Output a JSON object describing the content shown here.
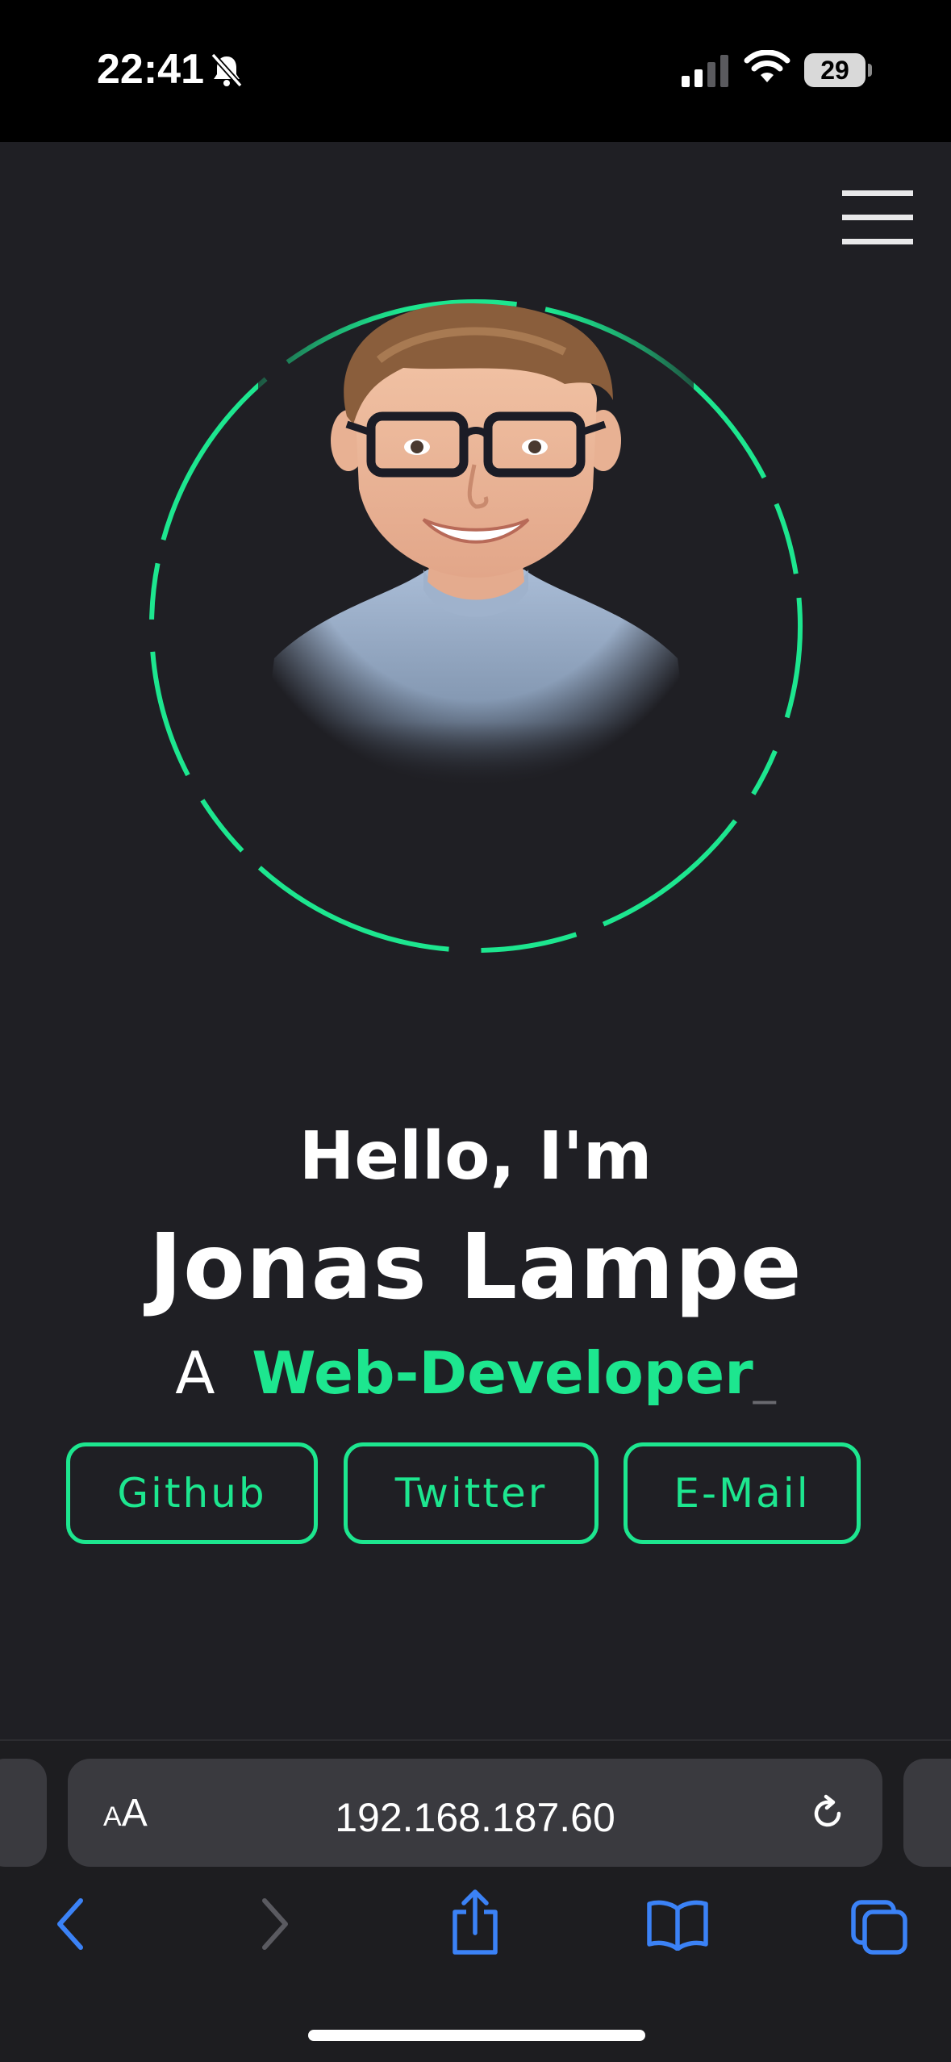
{
  "status_bar": {
    "time": "22:41",
    "battery": "29",
    "icons": [
      "bell-muted-icon",
      "cellular-signal-icon",
      "wifi-icon",
      "battery-icon"
    ]
  },
  "header": {
    "menu_icon": "hamburger-menu-icon"
  },
  "hero": {
    "greeting": "Hello, I'm",
    "name": "Jonas Lampe",
    "role_prefix": "A",
    "role_word": "Web-Developer",
    "role_cursor": "_",
    "accent_color": "#1de68f",
    "buttons": [
      {
        "label": "Github"
      },
      {
        "label": "Twitter"
      },
      {
        "label": "E-Mail"
      }
    ]
  },
  "browser": {
    "aa_small": "A",
    "aa_large": "A",
    "url": "192.168.187.60",
    "toolbar_icons": [
      "back-icon",
      "forward-icon",
      "share-icon",
      "bookmarks-icon",
      "tabs-icon"
    ],
    "accent_color": "#3b82f6"
  }
}
